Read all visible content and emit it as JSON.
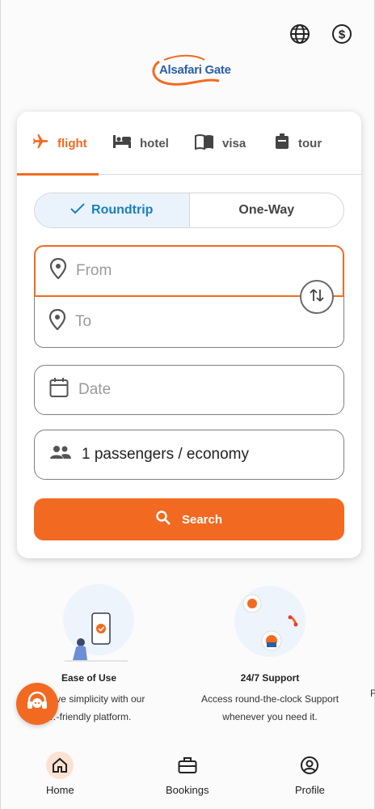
{
  "header": {
    "logo_text": "Alsafari Gate",
    "icons": [
      "globe-icon",
      "dollar-icon"
    ]
  },
  "tabs": [
    {
      "label": "flight",
      "icon": "plane-icon",
      "active": true
    },
    {
      "label": "hotel",
      "icon": "bed-icon",
      "active": false
    },
    {
      "label": "visa",
      "icon": "book-icon",
      "active": false
    },
    {
      "label": "tour",
      "icon": "luggage-icon",
      "active": false
    }
  ],
  "trip_type": {
    "roundtrip": "Roundtrip",
    "oneway": "One-Way",
    "selected": "Roundtrip"
  },
  "form": {
    "from_placeholder": "From",
    "to_placeholder": "To",
    "date_placeholder": "Date",
    "passengers": "1 passengers / economy",
    "search_label": "Search"
  },
  "features": [
    {
      "title": "Ease of Use",
      "desc_line1": "E…itive simplicity with our",
      "desc_line2": "…-friendly platform.",
      "icon": "phone-check-illustration"
    },
    {
      "title": "24/7 Support",
      "desc_line1": "Access round-the-clock Support",
      "desc_line2": "whenever you need it.",
      "icon": "support-illustration"
    }
  ],
  "nav": {
    "home": "Home",
    "bookings": "Bookings",
    "profile": "Profile"
  },
  "colors": {
    "accent": "#f26a21",
    "active_blue": "#1a7fc1",
    "toggle_bg": "#eaf3fc"
  }
}
